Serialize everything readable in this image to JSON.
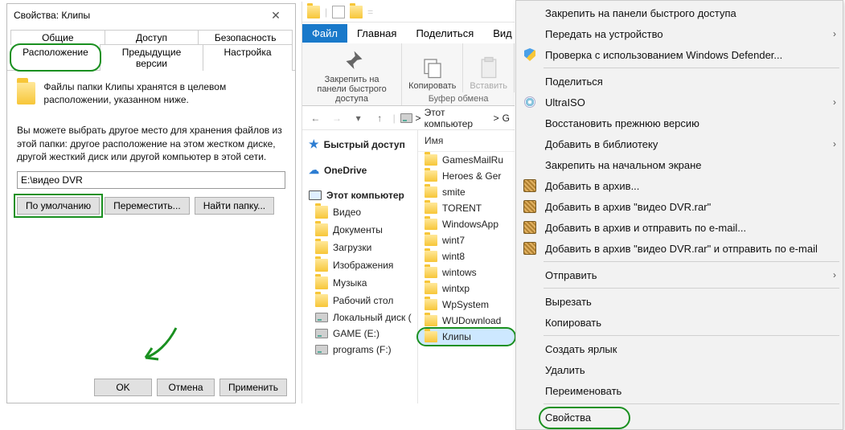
{
  "dialog": {
    "title": "Свойства: Клипы",
    "tabs": {
      "general": "Общие",
      "sharing": "Доступ",
      "security": "Безопасность",
      "location": "Расположение",
      "previous": "Предыдущие версии",
      "settings": "Настройка"
    },
    "line1": "Файлы папки Клипы хранятся в целевом расположении, указанном ниже.",
    "line2": "Вы можете выбрать другое место для хранения файлов из этой папки: другое расположение на этом жестком диске, другой жесткий диск или другой компьютер в этой сети.",
    "path": "E:\\видео DVR",
    "btn_default": "По умолчанию",
    "btn_move": "Переместить...",
    "btn_find": "Найти папку...",
    "ok": "OK",
    "cancel": "Отмена",
    "apply": "Применить"
  },
  "explorer": {
    "ribbon": {
      "file": "Файл",
      "home": "Главная",
      "share": "Поделиться",
      "view": "Вид",
      "pin": "Закрепить на панели быстрого доступа",
      "copy": "Копировать",
      "paste": "Вставить",
      "clipboard_caption": "Буфер обмена"
    },
    "breadcrumb": {
      "root": "Этот компьютер",
      "sep": ">"
    },
    "nav": {
      "quick": "Быстрый доступ",
      "onedrive": "OneDrive",
      "pc": "Этот компьютер",
      "video": "Видео",
      "docs": "Документы",
      "downloads": "Загрузки",
      "images": "Изображения",
      "music": "Музыка",
      "desktop": "Рабочий стол",
      "localc": "Локальный диск (",
      "game": "GAME (E:)",
      "programs": "programs (F:)"
    },
    "column_name": "Имя",
    "files": [
      "GamesMailRu",
      "Heroes & Ger",
      "smite",
      "TORENT",
      "WindowsApp",
      "wint7",
      "wint8",
      "wintows",
      "wintxp",
      "WpSystem",
      "WUDownload",
      "Клипы"
    ]
  },
  "ctx": {
    "pin_quick": "Закрепить на панели быстрого доступа",
    "send_device": "Передать на устройство",
    "defender": "Проверка с использованием Windows Defender...",
    "share": "Поделиться",
    "ultraiso": "UltraISO",
    "restore": "Восстановить прежнюю версию",
    "library": "Добавить в библиотеку",
    "pin_start": "Закрепить на начальном экране",
    "archive": "Добавить в архив...",
    "archive_named": "Добавить в архив \"видео DVR.rar\"",
    "archive_mail": "Добавить в архив и отправить по e-mail...",
    "archive_named_mail": "Добавить в архив \"видео DVR.rar\" и отправить по e-mail",
    "send": "Отправить",
    "cut": "Вырезать",
    "copy": "Копировать",
    "shortcut": "Создать ярлык",
    "delete": "Удалить",
    "rename": "Переименовать",
    "properties": "Свойства"
  }
}
